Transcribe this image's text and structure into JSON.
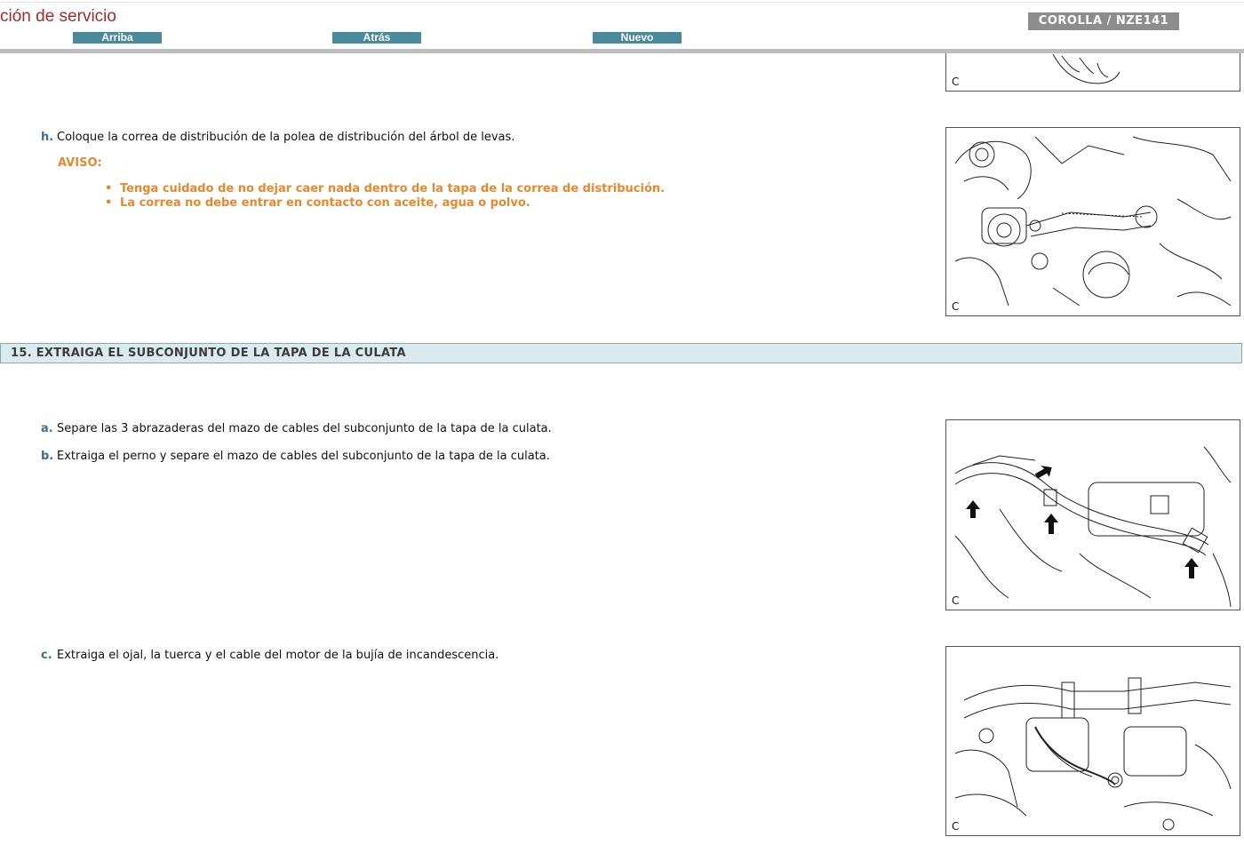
{
  "header": {
    "title": "ción de servicio",
    "nav": {
      "top": "Arriba",
      "back": "Atrás",
      "new": "Nuevo"
    },
    "model": "COROLLA / NZE141"
  },
  "figure_label": "C",
  "step_h": {
    "letter": "h.",
    "text": "Coloque la correa de distribución de la polea de distribución del árbol de levas.",
    "notice_label": "AVISO:",
    "notices": [
      "Tenga cuidado de no dejar caer nada dentro de la tapa de la correa de distribución.",
      "La correa no debe entrar en contacto con aceite, agua o polvo."
    ]
  },
  "section15": {
    "title": "15. EXTRAIGA EL SUBCONJUNTO DE LA TAPA DE LA CULATA"
  },
  "steps15": [
    {
      "letter": "a.",
      "text": "Separe las 3 abrazaderas del mazo de cables del subconjunto de la tapa de la culata."
    },
    {
      "letter": "b.",
      "text": "Extraiga el perno y separe el mazo de cables del subconjunto de la tapa de la culata."
    },
    {
      "letter": "c.",
      "text": "Extraiga el ojal, la tuerca y el cable del motor de la bujía de incandescencia."
    }
  ]
}
